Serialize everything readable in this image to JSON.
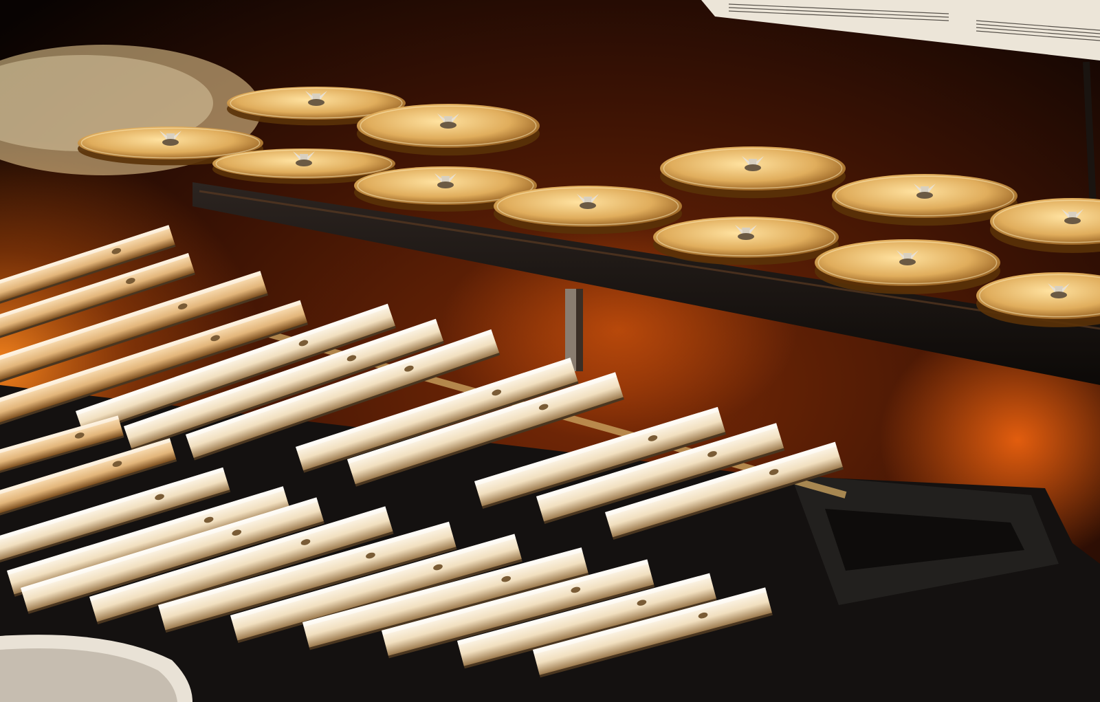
{
  "photo": {
    "subject": "glockenspiel-with-antique-cymbals",
    "palette": {
      "background": "#0a0402",
      "warm_glow": "#ff7a1a",
      "bar_light": "#fff3dc",
      "bar_shadow": "#a88a5e",
      "cymbal": "#e8b665",
      "cymbal_edge": "#7a4a14",
      "frame": "#151210"
    }
  }
}
